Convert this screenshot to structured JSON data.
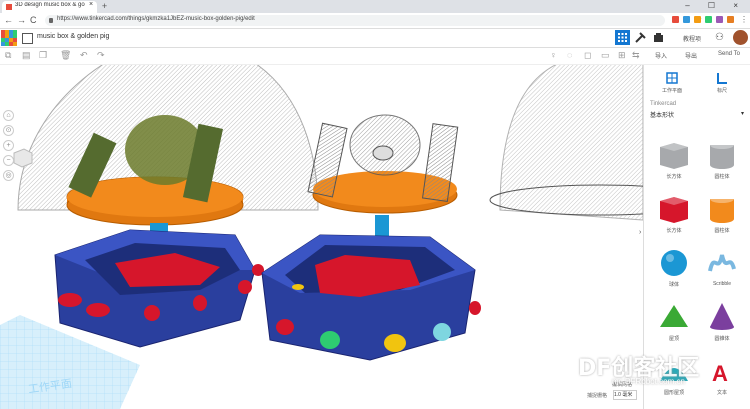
{
  "browser": {
    "tab_title": "3D design music box & golde",
    "tab_close": "×",
    "new_tab": "+",
    "window_controls": "– ☐ ×",
    "back": "←",
    "forward": "→",
    "reload": "C",
    "url": "https://www.tinkercad.com/things/gkmzka1JbEZ-music-box-golden-pig/edit",
    "star": "☆"
  },
  "app": {
    "logo_colors": [
      "#e74c3c",
      "#f39c12",
      "#3498db",
      "#2ecc71",
      "#e74c3c",
      "#f39c12",
      "#3498db",
      "#2ecc71",
      "#2ecc71",
      "#3498db",
      "#f39c12",
      "#e74c3c",
      "#3498db",
      "#2ecc71",
      "#e74c3c",
      "#f39c12"
    ],
    "design_name": "music box & golden pig",
    "header_text": "教程项",
    "accent": "#1477d1"
  },
  "toolbar": {
    "right": {
      "import": "导入",
      "export": "导出",
      "send_to": "Send To"
    }
  },
  "sidebar": {
    "workplane": "工作平面",
    "ruler": "标尺",
    "library_label": "Tinkercad",
    "library_select": "基本形状",
    "shapes": [
      {
        "name": "长方体",
        "icon": "box-striped-icon",
        "color": "#a7a9ac"
      },
      {
        "name": "圆柱体",
        "icon": "cylinder-striped-icon",
        "color": "#a7a9ac"
      },
      {
        "name": "长方体",
        "icon": "box-icon",
        "color": "#d6162b"
      },
      {
        "name": "圆柱体",
        "icon": "cylinder-icon",
        "color": "#f28a1c"
      },
      {
        "name": "球体",
        "icon": "sphere-icon",
        "color": "#1b97d4"
      },
      {
        "name": "Scribble",
        "icon": "scribble-icon",
        "color": "#7ab8e0"
      },
      {
        "name": "屋顶",
        "icon": "roof-icon",
        "color": "#3aa935"
      },
      {
        "name": "圆锥体",
        "icon": "cone-icon",
        "color": "#7b3f9e"
      },
      {
        "name": "圆形屋顶",
        "icon": "round-roof-icon",
        "color": "#2aa9b8"
      },
      {
        "name": "文本",
        "icon": "text-icon",
        "color": "#d6162b"
      }
    ]
  },
  "viewport": {
    "workplane_label": "工作平面",
    "snap_label": "编辑网格",
    "snap_grid_label": "捕捉栅格",
    "snap_grid_value": "1.0 毫米"
  },
  "watermark": {
    "main": "DF创客社区",
    "sub": "mc.DFRobot.com.cn"
  }
}
